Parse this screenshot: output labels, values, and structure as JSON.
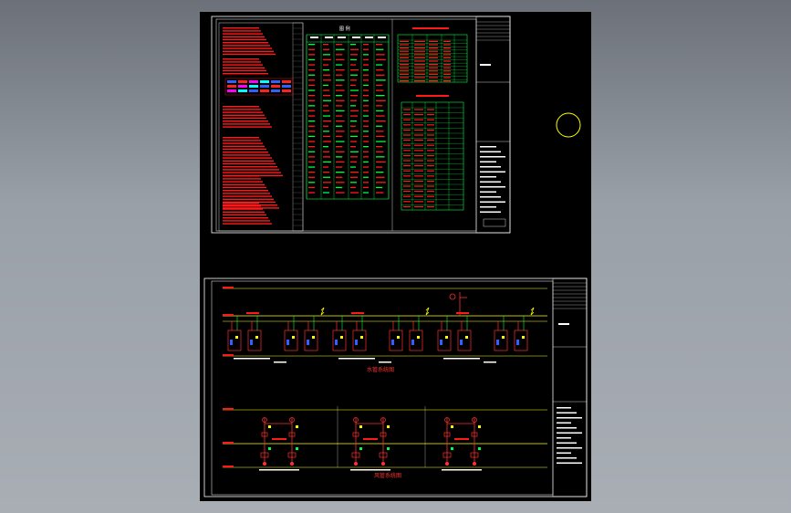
{
  "viewport": {
    "background_top": "#6b7079",
    "background_bottom": "#a9aeb5",
    "paper": "#000000"
  },
  "colors": {
    "frame": "#ffffff",
    "red_text": "#ff1a1a",
    "table_green": "#00ff40",
    "pipe_yellow": "#ffff00",
    "pipe_red": "#ff3030",
    "accent_blue": "#3060ff",
    "cursor_ring": "#ffff00"
  },
  "top_sheet": {
    "notes_column": {
      "rows": 38
    },
    "legend_table": {
      "header": "图  例",
      "columns": 6,
      "rows": 30
    },
    "equipment_table": {
      "columns": 5,
      "rows": 13
    },
    "material_table": {
      "columns": 5,
      "rows": 20
    }
  },
  "bottom_sheet": {
    "diagram_1_title": "水管系统图",
    "diagram_2_title": "风管系统图",
    "unit_groups": 3,
    "riser_groups": 3
  },
  "cursor": {
    "shape": "ring-icon"
  }
}
